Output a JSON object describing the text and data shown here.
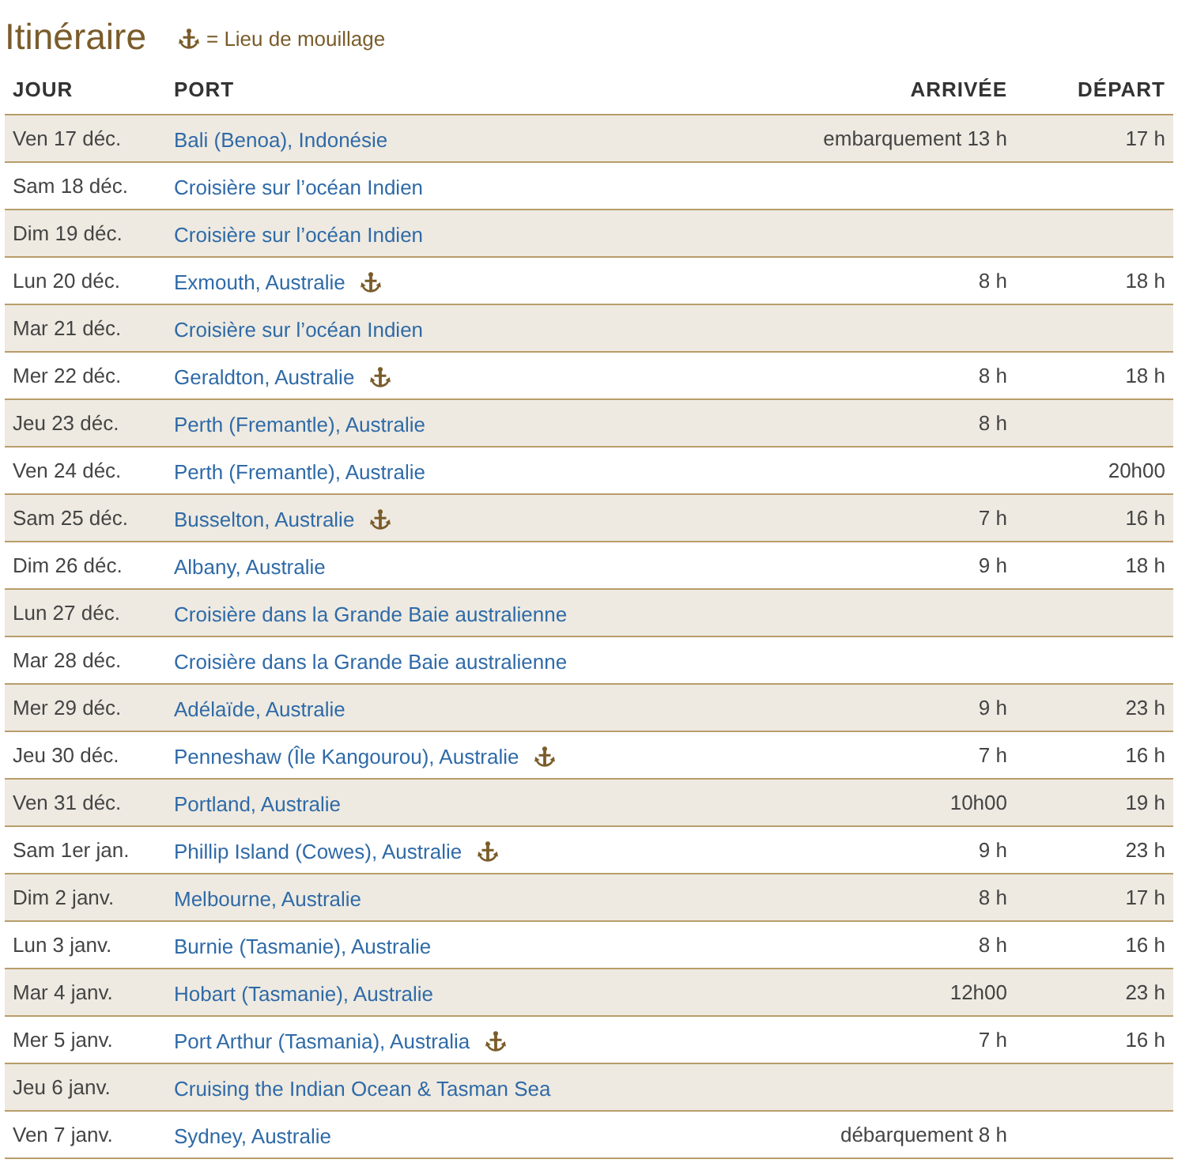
{
  "title": "Itinéraire",
  "legend": {
    "text": "= Lieu de mouillage"
  },
  "columns": [
    "JOUR",
    "PORT",
    "ARRIVÉE",
    "DÉPART"
  ],
  "rows": [
    {
      "day": "Ven 17 déc.",
      "port": "Bali (Benoa), Indonésie",
      "arrival": "embarquement 13 h",
      "departure": "17 h",
      "anchorage": false
    },
    {
      "day": "Sam 18 déc.",
      "port": "Croisière sur l’océan Indien",
      "anchorage": false
    },
    {
      "day": "Dim 19 déc.",
      "port": "Croisière sur l’océan Indien",
      "anchorage": false
    },
    {
      "day": "Lun 20 déc.",
      "port": "Exmouth, Australie",
      "arrival": "8 h",
      "departure": "18 h",
      "anchorage": true
    },
    {
      "day": "Mar 21 déc.",
      "port": "Croisière sur l’océan Indien",
      "anchorage": false
    },
    {
      "day": "Mer 22 déc.",
      "port": "Geraldton, Australie",
      "arrival": "8 h",
      "departure": "18 h",
      "anchorage": true
    },
    {
      "day": "Jeu 23 déc.",
      "port": "Perth (Fremantle), Australie",
      "arrival": "8 h",
      "anchorage": false
    },
    {
      "day": "Ven 24 déc.",
      "port": "Perth (Fremantle), Australie",
      "departure": "20h00",
      "anchorage": false
    },
    {
      "day": "Sam 25 déc.",
      "port": "Busselton, Australie",
      "arrival": "7 h",
      "departure": "16 h",
      "anchorage": true
    },
    {
      "day": "Dim 26 déc.",
      "port": "Albany, Australie",
      "arrival": "9 h",
      "departure": "18 h",
      "anchorage": false
    },
    {
      "day": "Lun 27 déc.",
      "port": "Croisière dans la Grande Baie australienne",
      "anchorage": false
    },
    {
      "day": "Mar 28 déc.",
      "port": "Croisière dans la Grande Baie australienne",
      "anchorage": false
    },
    {
      "day": "Mer 29 déc.",
      "port": "Adélaïde, Australie",
      "arrival": "9 h",
      "departure": "23 h",
      "anchorage": false
    },
    {
      "day": "Jeu 30 déc.",
      "port": "Penneshaw (Île Kangourou), Australie",
      "arrival": "7 h",
      "departure": "16 h",
      "anchorage": true
    },
    {
      "day": "Ven 31 déc.",
      "port": "Portland, Australie",
      "arrival": "10h00",
      "departure": "19 h",
      "anchorage": false
    },
    {
      "day": "Sam 1er jan.",
      "port": "Phillip Island (Cowes), Australie",
      "arrival": "9 h",
      "departure": "23 h",
      "anchorage": true
    },
    {
      "day": "Dim 2 janv.",
      "port": "Melbourne, Australie",
      "arrival": "8 h",
      "departure": "17 h",
      "anchorage": false
    },
    {
      "day": "Lun 3 janv.",
      "port": "Burnie (Tasmanie), Australie",
      "arrival": "8 h",
      "departure": "16 h",
      "anchorage": false
    },
    {
      "day": "Mar 4 janv.",
      "port": "Hobart (Tasmanie), Australie",
      "arrival": "12h00",
      "departure": "23 h",
      "anchorage": false
    },
    {
      "day": "Mer 5 janv.",
      "port": "Port Arthur (Tasmania), Australia",
      "arrival": "7 h",
      "departure": "16 h",
      "anchorage": true
    },
    {
      "day": "Jeu 6 janv.",
      "port": "Cruising the Indian Ocean & Tasman Sea",
      "anchorage": false
    },
    {
      "day": "Ven 7 janv.",
      "port": "Sydney, Australie",
      "arrival": "débarquement 8 h",
      "anchorage": false
    }
  ]
}
